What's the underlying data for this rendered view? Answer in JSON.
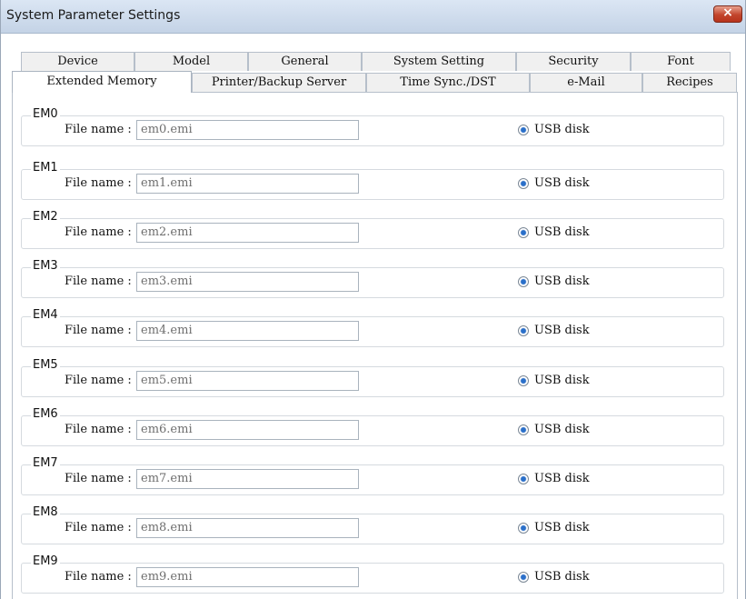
{
  "window": {
    "title": "System Parameter Settings",
    "close_icon": "×"
  },
  "tabs_row1": [
    {
      "label": "Device"
    },
    {
      "label": "Model"
    },
    {
      "label": "General"
    },
    {
      "label": "System Setting"
    },
    {
      "label": "Security"
    },
    {
      "label": "Font"
    }
  ],
  "tabs_row2": [
    {
      "label": "Extended Memory",
      "selected": true
    },
    {
      "label": "Printer/Backup Server"
    },
    {
      "label": "Time Sync./DST"
    },
    {
      "label": "e-Mail"
    },
    {
      "label": "Recipes"
    }
  ],
  "memories": [
    {
      "name": "EM0",
      "file_label": "File name :",
      "file_value": "em0.emi",
      "storage": "USB disk"
    },
    {
      "name": "EM1",
      "file_label": "File name :",
      "file_value": "em1.emi",
      "storage": "USB disk"
    },
    {
      "name": "EM2",
      "file_label": "File name :",
      "file_value": "em2.emi",
      "storage": "USB disk"
    },
    {
      "name": "EM3",
      "file_label": "File name :",
      "file_value": "em3.emi",
      "storage": "USB disk"
    },
    {
      "name": "EM4",
      "file_label": "File name :",
      "file_value": "em4.emi",
      "storage": "USB disk"
    },
    {
      "name": "EM5",
      "file_label": "File name :",
      "file_value": "em5.emi",
      "storage": "USB disk"
    },
    {
      "name": "EM6",
      "file_label": "File name :",
      "file_value": "em6.emi",
      "storage": "USB disk"
    },
    {
      "name": "EM7",
      "file_label": "File name :",
      "file_value": "em7.emi",
      "storage": "USB disk"
    },
    {
      "name": "EM8",
      "file_label": "File name :",
      "file_value": "em8.emi",
      "storage": "USB disk"
    },
    {
      "name": "EM9",
      "file_label": "File name :",
      "file_value": "em9.emi",
      "storage": "USB disk"
    }
  ],
  "colors": {
    "titlebar": "#c4d3e6",
    "close_button": "#c2452c",
    "radio_selected": "#2a6fc9"
  }
}
